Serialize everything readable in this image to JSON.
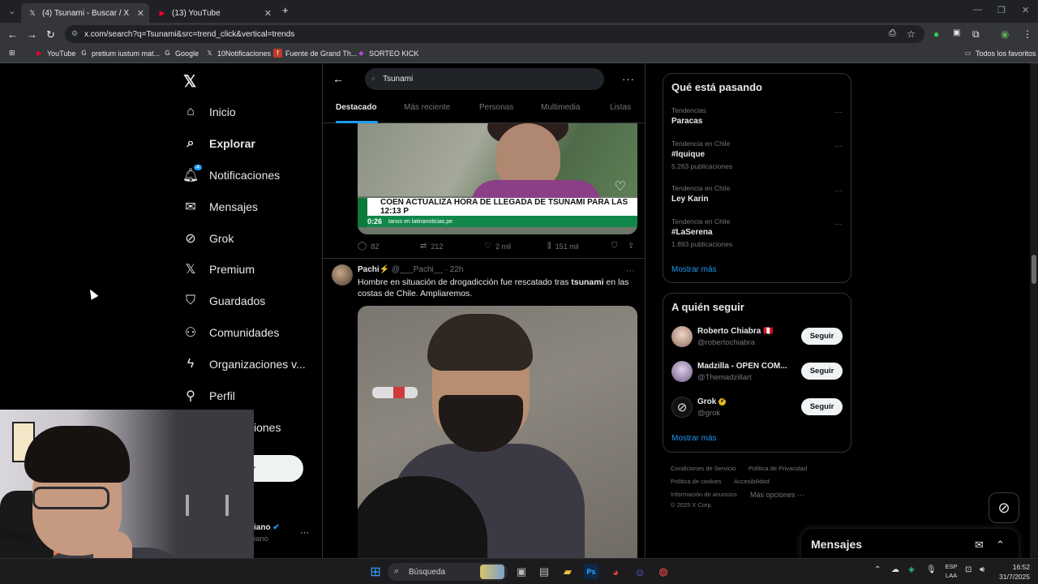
{
  "browser": {
    "tabs": [
      {
        "title": "(4) Tsunami - Buscar / X",
        "icon": "x-logo-icon"
      },
      {
        "title": "(13) YouTube",
        "icon": "youtube-icon"
      }
    ],
    "url": "x.com/search?q=Tsunami&src=trend_click&vertical=trends",
    "bookmarks": [
      {
        "label": "YouTube",
        "icon": "youtube-icon"
      },
      {
        "label": "pretium iustum mat...",
        "icon": "google-icon"
      },
      {
        "label": "Google",
        "icon": "google-icon"
      },
      {
        "label": "10Notificaciones",
        "icon": "x-logo-icon"
      },
      {
        "label": "Fuente de Grand Th...",
        "icon": "f-icon"
      },
      {
        "label": "SORTEO KICK",
        "icon": "kick-icon"
      }
    ],
    "all_bookmarks": "Todos los favoritos"
  },
  "nav": {
    "items": [
      {
        "label": "Inicio",
        "icon": "home-icon"
      },
      {
        "label": "Explorar",
        "icon": "search-icon"
      },
      {
        "label": "Notificaciones",
        "icon": "bell-icon",
        "badge": "4"
      },
      {
        "label": "Mensajes",
        "icon": "mail-icon"
      },
      {
        "label": "Grok",
        "icon": "grok-icon"
      },
      {
        "label": "Premium",
        "icon": "x-logo-icon"
      },
      {
        "label": "Guardados",
        "icon": "bookmark-icon"
      },
      {
        "label": "Comunidades",
        "icon": "communities-icon"
      },
      {
        "label": "Organizaciones v...",
        "icon": "lightning-icon"
      },
      {
        "label": "Perfil",
        "icon": "person-icon"
      }
    ],
    "more_fragment": "iones",
    "post_fragment": "r",
    "account_name_fragment": "iano",
    "account_handle_fragment": "iano"
  },
  "search": {
    "query": "Tsunami",
    "tabs": [
      "Destacado",
      "Más reciente",
      "Personas",
      "Multimedia",
      "Listas"
    ]
  },
  "tweet1": {
    "banner": "COEN ACTUALIZA HORA DE LLEGADA DE TSUNAMI PARA LAS 12:13 P",
    "strip": "tanos en latinanoticias.pe",
    "time": "0:26",
    "replies": "82",
    "reposts": "212",
    "likes": "2 mil",
    "views": "151 mil"
  },
  "tweet2": {
    "name": "Pachi⚡",
    "handle": "@___Pachi__",
    "age": "· 22h",
    "text_before": "Hombre en situación de drogadicción fue rescatado tras ",
    "text_bold": "tsunami",
    "text_after": " en las costas de Chile. Ampliaremos."
  },
  "trends": {
    "title": "Qué está pasando",
    "items": [
      {
        "context": "Tendencias",
        "name": "Paracas",
        "count": ""
      },
      {
        "context": "Tendencia en Chile",
        "name": "#Iquique",
        "count": "5.263 publicaciones"
      },
      {
        "context": "Tendencia en Chile",
        "name": "Ley Karin",
        "count": ""
      },
      {
        "context": "Tendencia en Chile",
        "name": "#LaSerena",
        "count": "1.893 publicaciones"
      }
    ],
    "show_more": "Mostrar más"
  },
  "who_to_follow": {
    "title": "A quién seguir",
    "items": [
      {
        "name": "Roberto Chiabra 🇵🇪",
        "handle": "@robertochiabra",
        "button": "Seguir"
      },
      {
        "name": "Madzilla - OPEN COM...",
        "handle": "@Themadzillart",
        "button": "Seguir"
      },
      {
        "name": "Grok",
        "handle": "@grok",
        "button": "Seguir"
      }
    ],
    "show_more": "Mostrar más"
  },
  "footer": {
    "links": [
      "Condiciones de Servicio",
      "Política de Privacidad",
      "Política de cookies",
      "Accesibilidad",
      "Información de anuncios",
      "Más opciones ···"
    ],
    "copyright": "© 2025 X Corp."
  },
  "messages": {
    "title": "Mensajes"
  },
  "taskbar": {
    "search": "Búsqueda",
    "lang_top": "ESP",
    "lang_bottom": "LAA",
    "time": "16:52",
    "date": "31/7/2025"
  },
  "colors": {
    "accent": "#1d9bf0",
    "background": "#000000"
  }
}
